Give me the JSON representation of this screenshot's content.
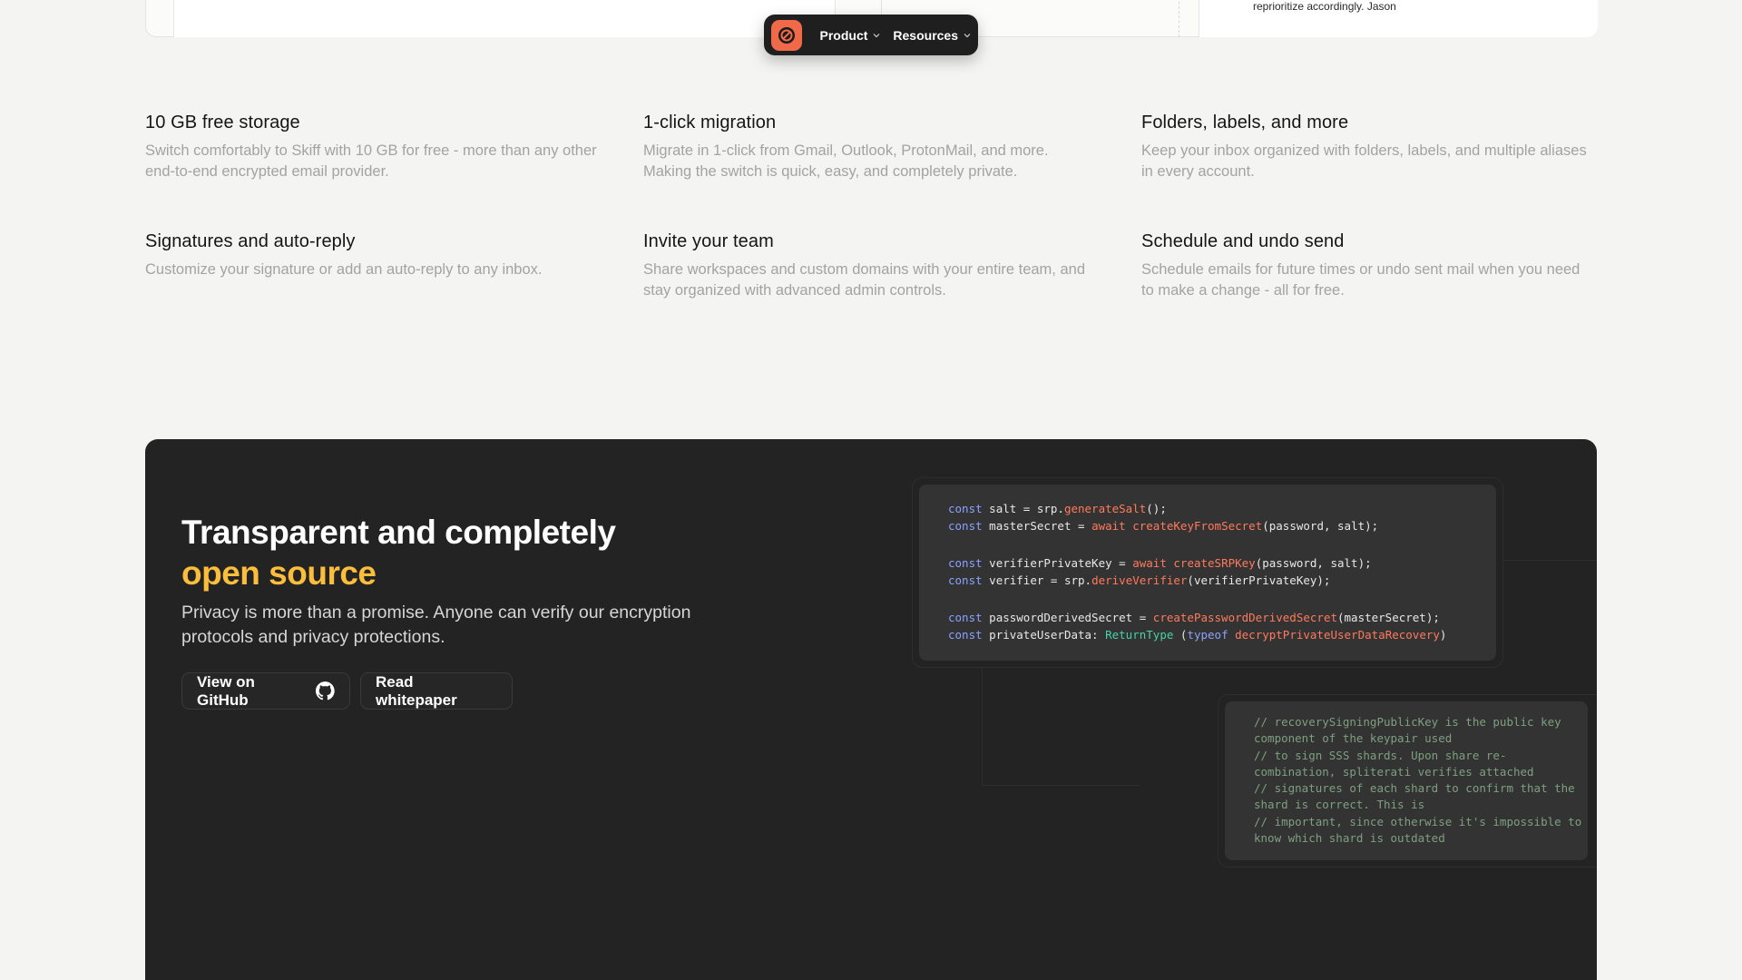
{
  "top_card": {
    "quote_fragment": "reprioritize accordingly. Jason"
  },
  "nav": {
    "logo_icon": "skiff-logo-icon",
    "items": [
      {
        "label": "Product",
        "icon": "chevron-down-icon"
      },
      {
        "label": "Resources",
        "icon": "chevron-down-icon"
      }
    ]
  },
  "features": [
    {
      "title": "10 GB free storage",
      "desc": "Switch comfortably to Skiff with 10 GB for free - more than any other end-to-end encrypted email provider."
    },
    {
      "title": "1-click migration",
      "desc": "Migrate in 1-click from Gmail, Outlook, ProtonMail, and more. Making the switch is quick, easy, and completely private."
    },
    {
      "title": "Folders, labels, and more",
      "desc": "Keep your inbox organized with folders, labels, and multiple aliases in every account."
    },
    {
      "title": "Signatures and auto-reply",
      "desc": "Customize your signature or add an auto-reply to any inbox."
    },
    {
      "title": "Invite your team",
      "desc": "Share workspaces and custom domains with your entire team, and stay organized with advanced admin controls."
    },
    {
      "title": "Schedule and undo send",
      "desc": "Schedule emails for future times or undo sent mail when you need to make a change - all for free."
    }
  ],
  "open_source": {
    "headline_line1": "Transparent and completely",
    "headline_accent": "open source",
    "subtitle": "Privacy is more than a promise. Anyone can verify our encryption protocols and privacy protections.",
    "github_button": "View on GitHub",
    "github_icon": "github-icon",
    "whitepaper_button": "Read whitepaper",
    "accent_color": "#fbbd3c"
  },
  "code_block_1": {
    "l1_kw": "const",
    "l1_a": " salt = srp.",
    "l1_fn": "generateSalt",
    "l1_b": "();",
    "l2_kw": "const",
    "l2_a": " masterSecret = ",
    "l2_kw2": "await",
    "l2_sp": " ",
    "l2_fn": "createKeyFromSecret",
    "l2_b": "(password, salt);",
    "l3_kw": "const",
    "l3_a": " verifierPrivateKey = ",
    "l3_kw2": "await",
    "l3_sp": " ",
    "l3_fn": "createSRPKey",
    "l3_b": "(password, salt);",
    "l4_kw": "const",
    "l4_a": " verifier = srp.",
    "l4_fn": "deriveVerifier",
    "l4_b": "(verifierPrivateKey);",
    "l5_kw": "const",
    "l5_a": " passwordDerivedSecret = ",
    "l5_fn": "createPasswordDerivedSecret",
    "l5_b": "(masterSecret);",
    "l6_kw": "const",
    "l6_a": " privateUserData: ",
    "l6_ty": "ReturnType",
    "l6_b": " (",
    "l6_kw2": "typeof",
    "l6_sp": " ",
    "l6_fn": "decryptPrivateUserDataRecovery",
    "l6_c": ")"
  },
  "code_block_2": {
    "lines": [
      "// recoverySigningPublicKey is the public key",
      "component of the keypair used",
      "// to sign SSS shards. Upon share re-",
      "combination, spliterati verifies attached",
      "// signatures of each shard to confirm that the",
      "shard is correct. This is",
      "// important, since otherwise it's impossible to",
      "know which shard is outdated"
    ]
  }
}
